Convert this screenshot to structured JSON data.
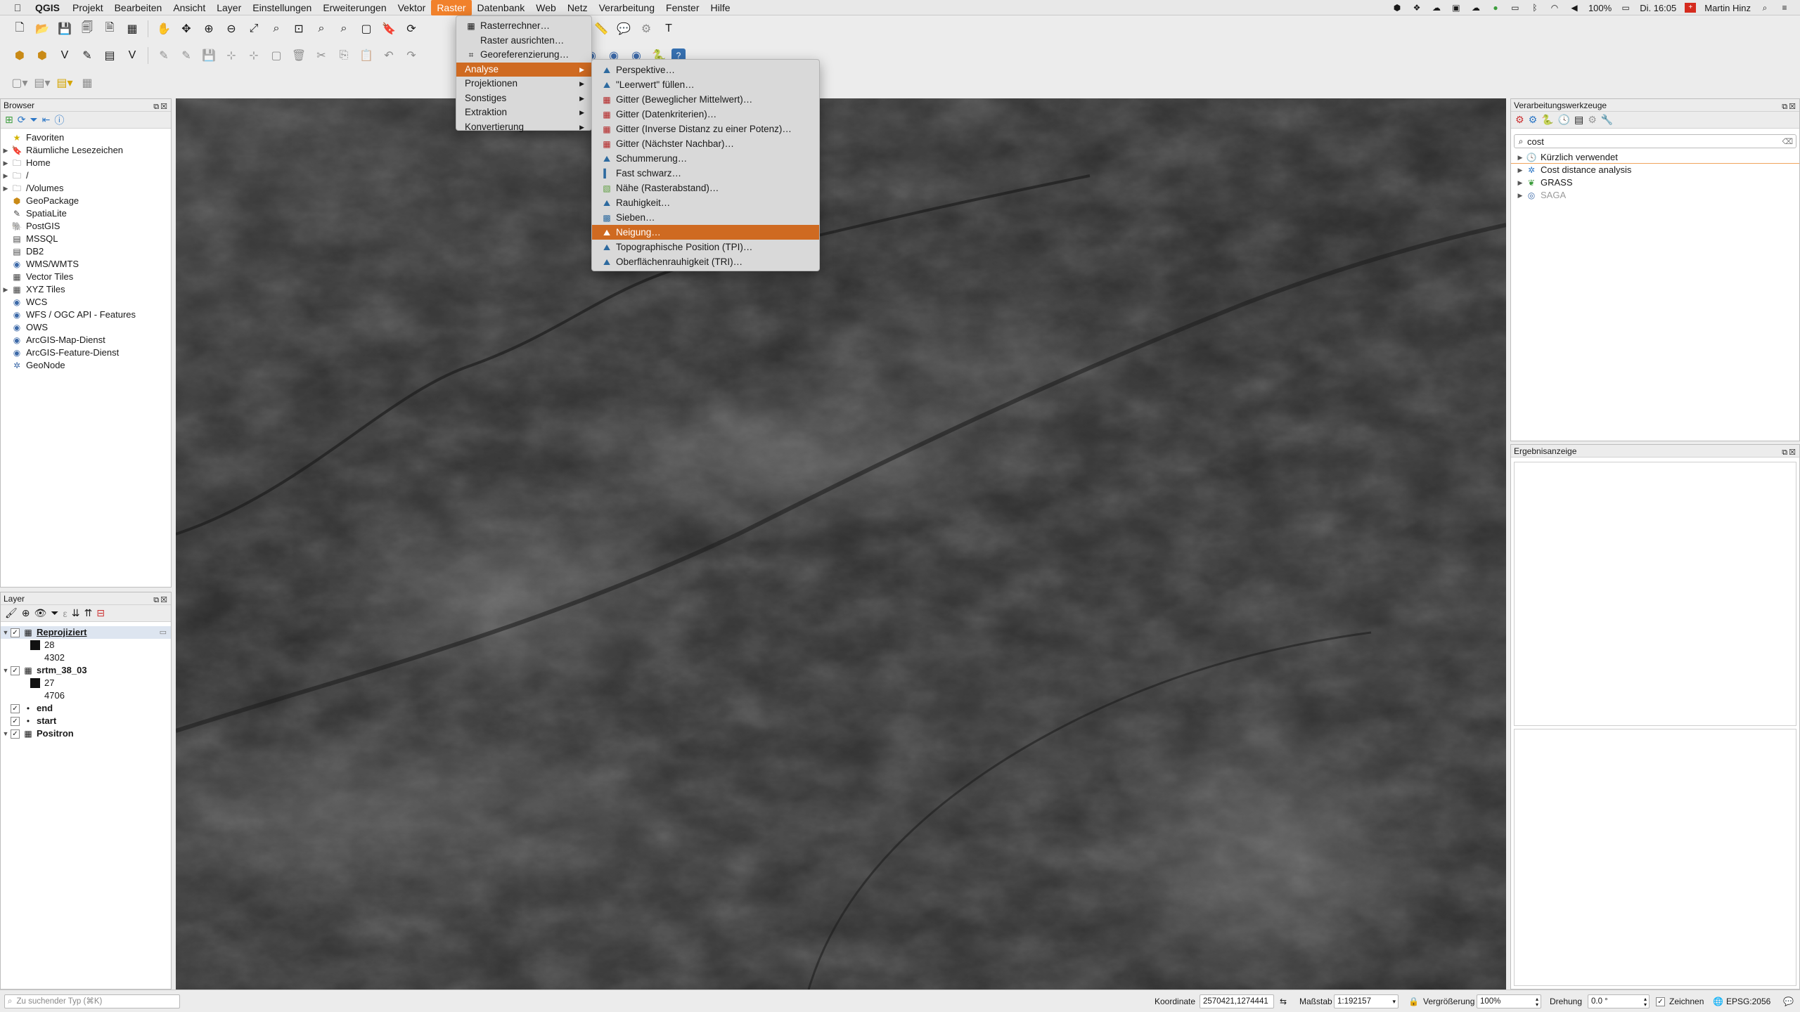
{
  "menubar": {
    "app": "QGIS",
    "items": [
      "Projekt",
      "Bearbeiten",
      "Ansicht",
      "Layer",
      "Einstellungen",
      "Erweiterungen",
      "Vektor",
      "Raster",
      "Datenbank",
      "Web",
      "Netz",
      "Verarbeitung",
      "Fenster",
      "Hilfe"
    ],
    "active": "Raster",
    "battery": "100%",
    "clock": "Di. 16:05",
    "user": "Martin Hinz"
  },
  "raster_menu": {
    "items": [
      {
        "label": "Rasterrechner…",
        "icon": "calculator-icon"
      },
      {
        "label": "Raster ausrichten…",
        "icon": ""
      },
      {
        "label": "Georeferenzierung…",
        "icon": "grid-icon"
      },
      {
        "label": "Analyse",
        "submenu": true
      },
      {
        "label": "Projektionen",
        "submenu": true
      },
      {
        "label": "Sonstiges",
        "submenu": true
      },
      {
        "label": "Extraktion",
        "submenu": true
      },
      {
        "label": "Konvertierung",
        "submenu": true
      }
    ]
  },
  "analyse_menu": {
    "items": [
      {
        "label": "Perspektive…",
        "icon": "terrain-icon"
      },
      {
        "label": "\"Leerwert\" füllen…",
        "icon": "terrain-icon"
      },
      {
        "label": "Gitter (Beweglicher Mittelwert)…",
        "icon": "red-grid-icon"
      },
      {
        "label": "Gitter (Datenkriterien)…",
        "icon": "red-grid-icon"
      },
      {
        "label": "Gitter (Inverse Distanz zu einer Potenz)…",
        "icon": "red-grid-icon"
      },
      {
        "label": "Gitter (Nächster Nachbar)…",
        "icon": "red-grid-icon"
      },
      {
        "label": "Schummerung…",
        "icon": "terrain-icon"
      },
      {
        "label": "Fast schwarz…",
        "icon": "bar-icon"
      },
      {
        "label": "Nähe (Rasterabstand)…",
        "icon": "proximity-icon"
      },
      {
        "label": "Rauhigkeit…",
        "icon": "terrain-icon"
      },
      {
        "label": "Sieben…",
        "icon": "sieve-icon"
      },
      {
        "label": "Neigung…",
        "icon": "terrain-icon",
        "highlight": true
      },
      {
        "label": "Topographische Position (TPI)…",
        "icon": "terrain-icon"
      },
      {
        "label": "Oberflächenrauhigkeit (TRI)…",
        "icon": "terrain-icon"
      }
    ]
  },
  "browser": {
    "title": "Browser",
    "items": [
      {
        "label": "Favoriten",
        "icon": "star-icon",
        "arrow": false
      },
      {
        "label": "Räumliche Lesezeichen",
        "icon": "bookmark-icon",
        "arrow": true
      },
      {
        "label": "Home",
        "icon": "folder-icon",
        "arrow": true
      },
      {
        "label": "/",
        "icon": "folder-icon",
        "arrow": true
      },
      {
        "label": "/Volumes",
        "icon": "folder-icon",
        "arrow": true
      },
      {
        "label": "GeoPackage",
        "icon": "geopackage-icon",
        "arrow": false
      },
      {
        "label": "SpatiaLite",
        "icon": "spatialite-icon",
        "arrow": false
      },
      {
        "label": "PostGIS",
        "icon": "postgis-icon",
        "arrow": false
      },
      {
        "label": "MSSQL",
        "icon": "mssql-icon",
        "arrow": false
      },
      {
        "label": "DB2",
        "icon": "db2-icon",
        "arrow": false
      },
      {
        "label": "WMS/WMTS",
        "icon": "globe-icon",
        "arrow": false
      },
      {
        "label": "Vector Tiles",
        "icon": "tiles-icon",
        "arrow": false
      },
      {
        "label": "XYZ Tiles",
        "icon": "tiles-icon",
        "arrow": true
      },
      {
        "label": "WCS",
        "icon": "globe-icon",
        "arrow": false
      },
      {
        "label": "WFS / OGC API - Features",
        "icon": "globe-icon",
        "arrow": false
      },
      {
        "label": "OWS",
        "icon": "globe-icon",
        "arrow": false
      },
      {
        "label": "ArcGIS-Map-Dienst",
        "icon": "arcgis-icon",
        "arrow": false
      },
      {
        "label": "ArcGIS-Feature-Dienst",
        "icon": "arcgis-icon",
        "arrow": false
      },
      {
        "label": "GeoNode",
        "icon": "geonode-icon",
        "arrow": false
      }
    ]
  },
  "layers": {
    "title": "Layer",
    "items": [
      {
        "label": "Reprojiziert",
        "bold": true,
        "underline": true,
        "checked": true,
        "arrow": true,
        "type": "raster"
      },
      {
        "label": "28",
        "sym": true
      },
      {
        "label": "4302",
        "sym": false
      },
      {
        "label": "srtm_38_03",
        "bold": true,
        "checked": true,
        "arrow": true,
        "type": "raster"
      },
      {
        "label": "27",
        "sym": true
      },
      {
        "label": "4706",
        "sym": false
      },
      {
        "label": "end",
        "bold": true,
        "checked": true,
        "arrow": false,
        "type": "point"
      },
      {
        "label": "start",
        "bold": true,
        "checked": true,
        "arrow": false,
        "type": "point"
      },
      {
        "label": "Positron",
        "bold": true,
        "checked": true,
        "arrow": true,
        "type": "raster"
      }
    ]
  },
  "processing": {
    "title": "Verarbeitungswerkzeuge",
    "search": "cost",
    "items": [
      {
        "label": "Kürzlich verwendet",
        "icon": "clock-icon",
        "grey": false
      },
      {
        "label": "Cost distance analysis",
        "icon": "gear-icon",
        "grey": false
      },
      {
        "label": "GRASS",
        "icon": "grass-icon",
        "grey": false
      },
      {
        "label": "SAGA",
        "icon": "saga-icon",
        "grey": true
      }
    ]
  },
  "results": {
    "title": "Ergebnisanzeige"
  },
  "status": {
    "search_placeholder": "Zu suchender Typ (⌘K)",
    "coord_label": "Koordinate",
    "coord_value": "2570421,1274441",
    "scale_label": "Maßstab",
    "scale_value": "1:192157",
    "mag_label": "Vergrößerung",
    "mag_value": "100%",
    "rot_label": "Drehung",
    "rot_value": "0.0 °",
    "render_label": "Zeichnen",
    "crs": "EPSG:2056"
  }
}
